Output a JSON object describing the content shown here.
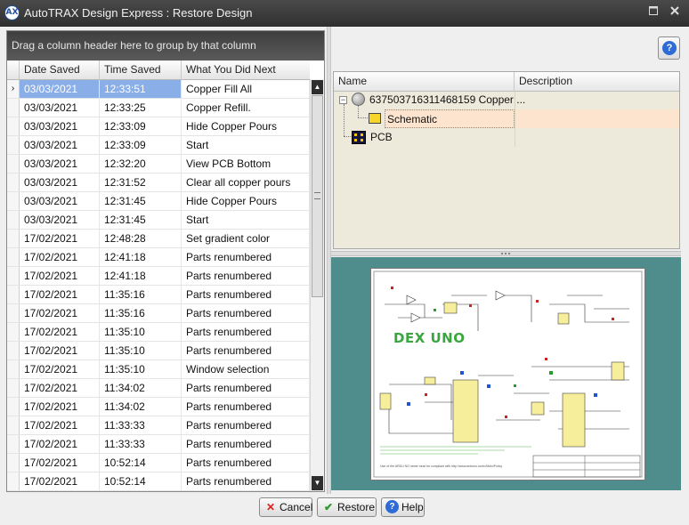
{
  "window": {
    "app_icon_glyph": "AX",
    "title": "AutoTRAX Design Express : Restore Design",
    "controls": [
      "maximize",
      "close"
    ]
  },
  "history_grid": {
    "group_hint": "Drag a column header here to group by that column",
    "columns": [
      "Date Saved",
      "Time Saved",
      "What You Did Next"
    ],
    "selected_index": 0,
    "rows": [
      [
        "03/03/2021",
        "12:33:51",
        "Copper Fill All"
      ],
      [
        "03/03/2021",
        "12:33:25",
        "Copper Refill."
      ],
      [
        "03/03/2021",
        "12:33:09",
        "Hide Copper Pours"
      ],
      [
        "03/03/2021",
        "12:33:09",
        "Start"
      ],
      [
        "03/03/2021",
        "12:32:20",
        "View PCB Bottom"
      ],
      [
        "03/03/2021",
        "12:31:52",
        "Clear all copper pours"
      ],
      [
        "03/03/2021",
        "12:31:45",
        "Hide Copper Pours"
      ],
      [
        "03/03/2021",
        "12:31:45",
        "Start"
      ],
      [
        "17/02/2021",
        "12:48:28",
        "Set gradient color"
      ],
      [
        "17/02/2021",
        "12:41:18",
        "Parts renumbered"
      ],
      [
        "17/02/2021",
        "12:41:18",
        "Parts renumbered"
      ],
      [
        "17/02/2021",
        "11:35:16",
        "Parts renumbered"
      ],
      [
        "17/02/2021",
        "11:35:16",
        "Parts renumbered"
      ],
      [
        "17/02/2021",
        "11:35:10",
        "Parts renumbered"
      ],
      [
        "17/02/2021",
        "11:35:10",
        "Parts renumbered"
      ],
      [
        "17/02/2021",
        "11:35:10",
        "Window selection"
      ],
      [
        "17/02/2021",
        "11:34:02",
        "Parts renumbered"
      ],
      [
        "17/02/2021",
        "11:34:02",
        "Parts renumbered"
      ],
      [
        "17/02/2021",
        "11:33:33",
        "Parts renumbered"
      ],
      [
        "17/02/2021",
        "11:33:33",
        "Parts renumbered"
      ],
      [
        "17/02/2021",
        "10:52:14",
        "Parts renumbered"
      ],
      [
        "17/02/2021",
        "10:52:14",
        "Parts renumbered"
      ]
    ]
  },
  "design_tree": {
    "columns": [
      "Name",
      "Description"
    ],
    "root": {
      "name": "637503716311468159 Copper ...",
      "description": "",
      "expander": "⊟"
    },
    "children": [
      {
        "name": "Schematic",
        "description": "",
        "selected": true,
        "icon": "schematic-icon"
      },
      {
        "name": "PCB",
        "description": "",
        "selected": false,
        "icon": "pcb-icon"
      }
    ]
  },
  "preview": {
    "sheet_title": "DEX UNO",
    "sheet_note": "Use of the ARDU NO name must be compliant with http://www.arduino.cc/en/Main/Policy"
  },
  "buttons": {
    "cancel": "Cancel",
    "restore": "Restore",
    "help": "Help",
    "help_top_glyph": "?"
  },
  "colors": {
    "titlebar": "#3a3a3a",
    "selection": "#8aaee8",
    "tree_selected": "#fce4cf",
    "preview_bg": "#4f8c8c",
    "sheet_title": "#3aa640"
  }
}
